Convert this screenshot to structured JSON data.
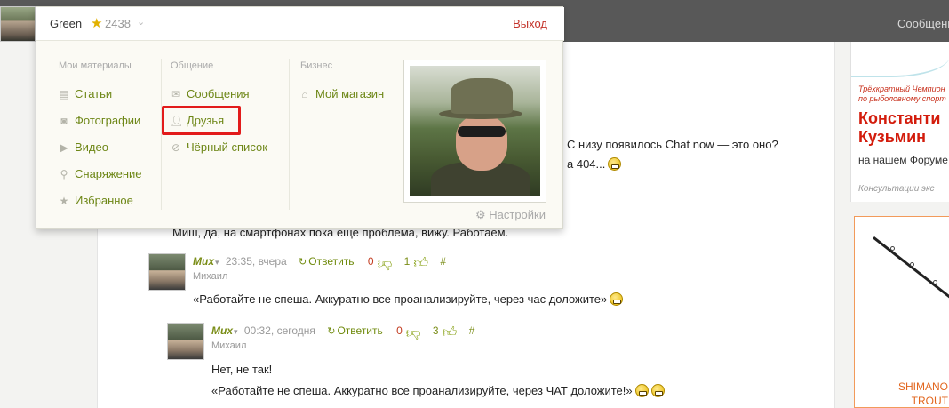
{
  "topbar": {
    "right_link": "Сообщения"
  },
  "user": {
    "name": "Green",
    "rating": "2438",
    "exit_label": "Выход"
  },
  "menu": {
    "columns": [
      {
        "title": "Мои материалы",
        "items": [
          {
            "label": "Статьи",
            "icon": "article-icon"
          },
          {
            "label": "Фотографии",
            "icon": "camera-icon"
          },
          {
            "label": "Видео",
            "icon": "play-icon"
          },
          {
            "label": "Снаряжение",
            "icon": "gear-equipment-icon"
          },
          {
            "label": "Избранное",
            "icon": "star-icon"
          }
        ]
      },
      {
        "title": "Общение",
        "items": [
          {
            "label": "Сообщения",
            "icon": "envelope-icon"
          },
          {
            "label": "Друзья",
            "icon": "user-icon",
            "highlighted": true
          },
          {
            "label": "Чёрный список",
            "icon": "blocked-icon"
          }
        ]
      },
      {
        "title": "Бизнес",
        "items": [
          {
            "label": "Мой магазин",
            "icon": "shop-icon"
          }
        ]
      }
    ],
    "settings_label": "Настройки"
  },
  "page": {
    "partial_line_1": "С низу появилось Chat now — это оно?",
    "partial_line_2": "а 404...",
    "reply_line": "Миш, да, на смартфонах пока еще проблема, вижу. Работаем."
  },
  "comments": [
    {
      "author": "Mux",
      "time": "23:35, вчера",
      "reply_label": "Ответить",
      "minus": "0",
      "plus": "1",
      "hash": "#",
      "name": "Михаил",
      "text": "«Работайте не спеша. Аккуратно все проанализируйте, через час доложите»"
    },
    {
      "author": "Mux",
      "time": "00:32, сегодня",
      "reply_label": "Ответить",
      "minus": "0",
      "plus": "3",
      "hash": "#",
      "name": "Михаил",
      "text": "Нет, не так!",
      "text2": "«Работайте не спеша. Аккуратно все проанализируйте, через ЧАТ доложите!»"
    }
  ],
  "sidebar": {
    "ad1_small_1": "Трёхкратный Чемпион",
    "ad1_small_2": "по рыболовному спорт",
    "ad1_name_1": "Константи",
    "ad1_name_2": "Кузьмин",
    "ad1_note": "на нашем Форуме",
    "ad1_foot": "Консультации экс",
    "ad2_line_1": "SHIMANO",
    "ad2_line_2": "TROUT"
  },
  "colors": {
    "accent_green": "#6e8717",
    "exit_red": "#c4332a",
    "highlight_red": "#e21b1b",
    "topbar": "#585858"
  }
}
